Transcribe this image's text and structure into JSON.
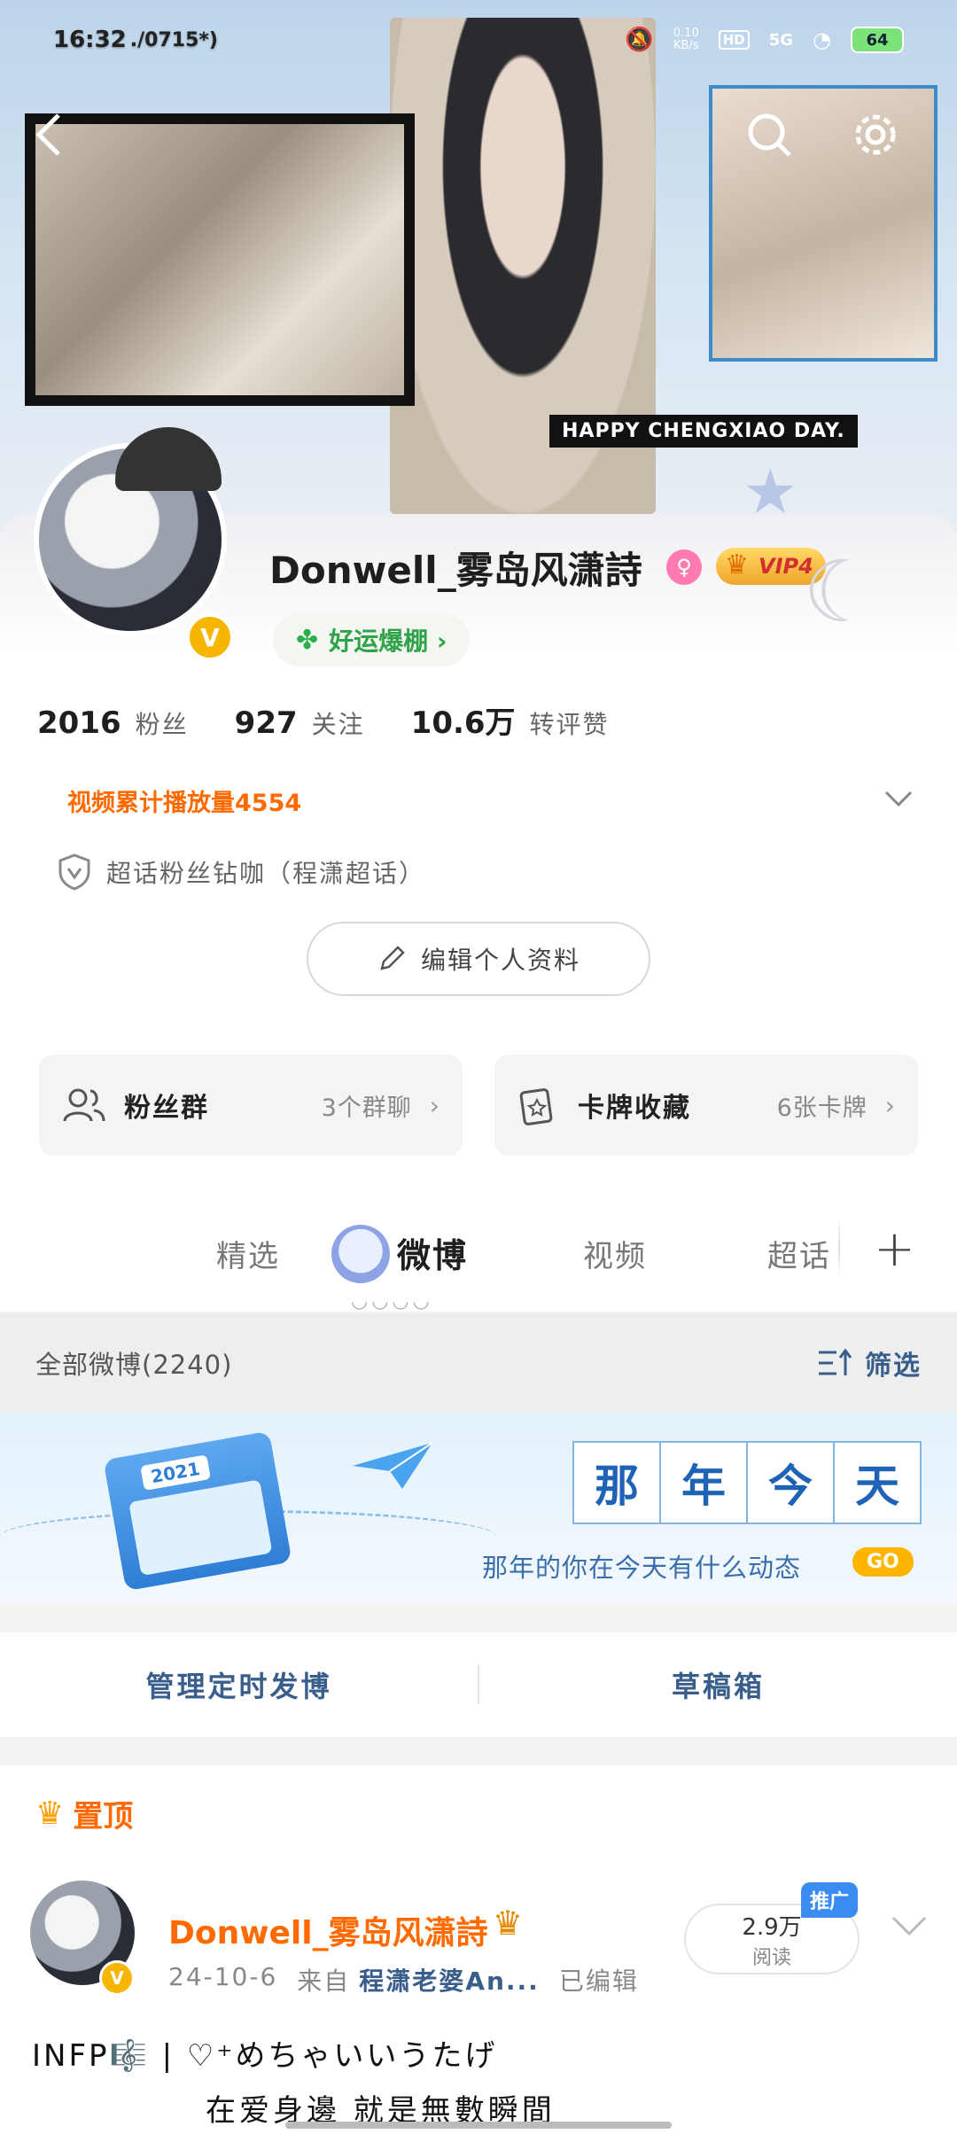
{
  "status_bar": {
    "time": "16:32",
    "extra": "./0715*)",
    "net_speed": "0.10",
    "net_unit": "KB/s",
    "hd": "HD",
    "signal": "5G",
    "battery": "64"
  },
  "banner": {
    "tagline": "HAPPY CHENGXIAO DAY."
  },
  "profile": {
    "username": "Donwell_雾岛风潇詩",
    "vip_label": "VIP4",
    "luck_label": "好运爆棚 ›",
    "stats": [
      {
        "value": "2016",
        "label": "粉丝"
      },
      {
        "value": "927",
        "label": "关注"
      },
      {
        "value": "10.6万",
        "label": "转评赞"
      }
    ],
    "video_count": "视频累计播放量4554",
    "super_fan": "超话粉丝钻咖（程潇超话）",
    "edit_button": "编辑个人资料"
  },
  "cards": [
    {
      "title": "粉丝群",
      "sub": "3个群聊",
      "icon": "group-icon"
    },
    {
      "title": "卡牌收藏",
      "sub": "6张卡牌",
      "icon": "card-icon"
    }
  ],
  "tabs": [
    {
      "label": "精选"
    },
    {
      "label": "微博"
    },
    {
      "label": "视频"
    },
    {
      "label": "超话"
    }
  ],
  "filter_bar": {
    "all_label": "全部微博(2240)",
    "filter_label": "筛选"
  },
  "memory_banner": {
    "year": "2021",
    "title_chars": [
      "那",
      "年",
      "今",
      "天"
    ],
    "subtitle": "那年的你在今天有什么动态",
    "go": "GO"
  },
  "manage": {
    "scheduled": "管理定时发博",
    "drafts": "草稿箱"
  },
  "pinned_post": {
    "pin_label": "置顶",
    "author": "Donwell_雾岛风潇詩",
    "date": "24-10-6",
    "from_label": "来自",
    "source": "程潇老婆An...",
    "edited": "已编辑",
    "reads_value": "2.9万",
    "reads_label": "阅读",
    "promo": "推广",
    "line1": "INFP🎼 | ♡⁺めちゃいいうたげ",
    "line2": "在爱身邊 就是無數瞬間"
  },
  "colors": {
    "accent_orange": "#ff6a00",
    "link_blue": "#3a5e8c",
    "vip_gold": "#f0a52b"
  }
}
